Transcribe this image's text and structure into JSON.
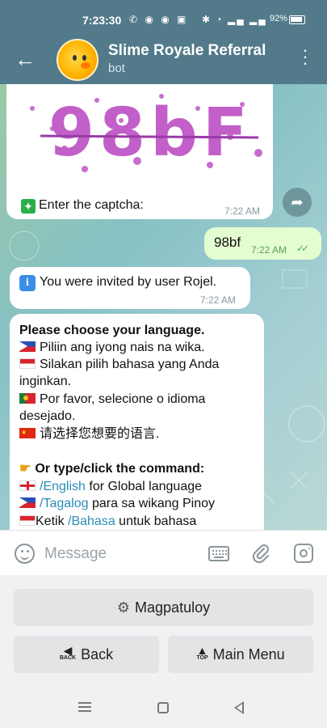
{
  "status_bar": {
    "time": "7:23:30",
    "battery": "92%",
    "app_icons": [
      "messenger-icon",
      "messenger-icon",
      "app-icon",
      "app-icon"
    ],
    "system_icons": [
      "bluetooth-icon",
      "wifi-icon",
      "signal-icon",
      "signal-icon"
    ]
  },
  "header": {
    "title": "Slime Royale Referral",
    "subtitle": "bot"
  },
  "messages": {
    "captcha": {
      "caption": "Enter the captcha:",
      "time": "7:22 AM",
      "image_text": "98bF"
    },
    "answer": {
      "text": "98bf",
      "time": "7:22 AM",
      "status": "read"
    },
    "invite": {
      "text": "You were invited by user Rojel.",
      "time": "7:22 AM"
    },
    "language": {
      "heading": "Please choose your language.",
      "tagalog": "Piliin ang iyong nais na wika.",
      "bahasa_1": "Silakan pilih bahasa yang Anda",
      "bahasa_2": "inginkan.",
      "portuguese_1": "Por favor, selecione o idioma",
      "portuguese_2": "desejado.",
      "chinese": "请选择您想要的语言.",
      "command_heading": "Or type/click the command:",
      "english_cmd": "/English",
      "english_rest": " for Global language",
      "tagalog_cmd": "/Tagalog",
      "tagalog_rest": " para sa wikang Pinoy",
      "bahasa_prefix": "Ketik ",
      "bahasa_cmd": "/Bahasa",
      "bahasa_rest": " untuk bahasa"
    }
  },
  "input": {
    "placeholder": "Message"
  },
  "keyboard": {
    "continue_label": "Magpatuloy",
    "back_label": "Back",
    "back_icon_text": "BACK",
    "menu_label": "Main Menu",
    "menu_icon_text": "TOP"
  },
  "colors": {
    "header": "#527a8a",
    "outgoing_bubble": "#e3fdd0",
    "link": "#2b8cb8",
    "captcha_ink": "#c25fc8"
  }
}
